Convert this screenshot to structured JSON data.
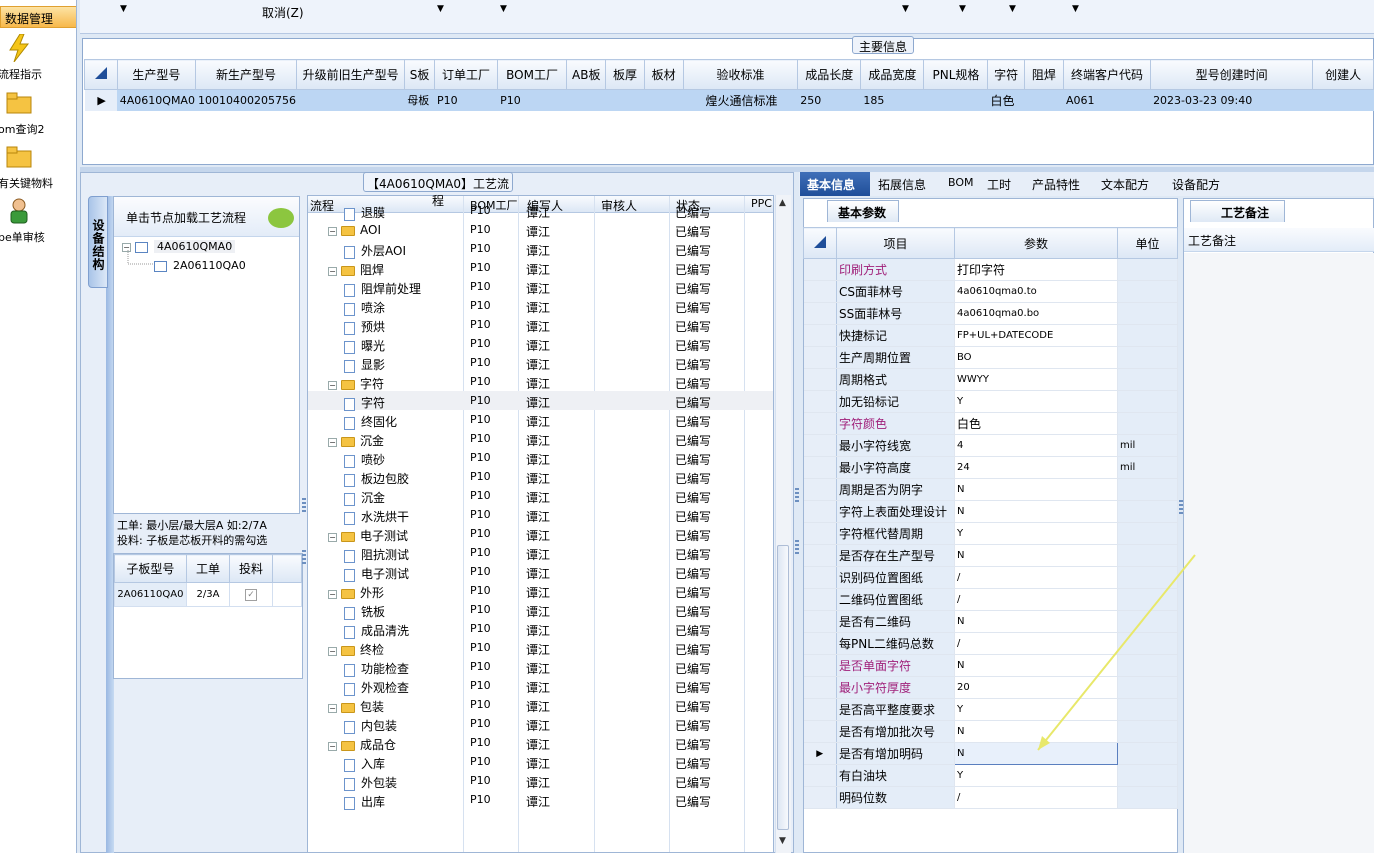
{
  "nav": {
    "header": "数据管理",
    "items": [
      {
        "label": "流程指示",
        "icon": "lightning-icon"
      },
      {
        "label": "om查询2",
        "icon": "folder-icon"
      },
      {
        "label": "有关键物料",
        "icon": "folder-icon"
      },
      {
        "label": "pe单审核",
        "icon": "user-icon"
      }
    ]
  },
  "toolbar": {
    "cancel_label": "取消(Z)"
  },
  "main_info": {
    "legend": "主要信息",
    "columns": [
      "生产型号",
      "新生产型号",
      "升级前旧生产型号",
      "S板",
      "订单工厂",
      "BOM工厂",
      "AB板",
      "板厚",
      "板材",
      "验收标准",
      "成品长度",
      "成品宽度",
      "PNL规格",
      "字符",
      "阻焊",
      "终端客户代码",
      "型号创建时间",
      "创建人"
    ],
    "row": [
      "4A0610QMA0",
      "10010400205756",
      "",
      "母板",
      "P10",
      "P10",
      "",
      "",
      "",
      "煌火通信标准",
      "250",
      "185",
      "",
      "白色",
      "",
      "A061",
      "2023-03-23 09:40",
      ""
    ]
  },
  "process": {
    "legend": "【4A0610QMA0】工艺流程",
    "side_tab": "设备结构",
    "tree_header": "单击节点加载工艺流程",
    "tree": {
      "root": "4A0610QMA0",
      "child": "2A06110QA0"
    },
    "hint_line1": "工单: 最小层/最大层A 如:2/7A",
    "hint_line2": "投料: 子板是芯板开料的需勾选",
    "sub_columns": [
      "子板型号",
      "工单",
      "投料"
    ],
    "sub_row": {
      "model": "2A06110QA0",
      "order": "2/3A",
      "checked": "✓"
    },
    "grid_columns": [
      "流程",
      "BOM工厂",
      "编写人",
      "审核人",
      "状态",
      "PPC"
    ],
    "rows": [
      {
        "name": "退膜",
        "type": "doc",
        "level": 2,
        "bom": "P10",
        "writer": "谭江",
        "status": "已编写"
      },
      {
        "name": "AOI",
        "type": "folder",
        "level": 1,
        "bom": "P10",
        "writer": "谭江",
        "status": "已编写"
      },
      {
        "name": "外层AOI",
        "type": "doc",
        "level": 2,
        "bom": "P10",
        "writer": "谭江",
        "status": "已编写"
      },
      {
        "name": "阻焊",
        "type": "folder",
        "level": 1,
        "bom": "P10",
        "writer": "谭江",
        "status": "已编写"
      },
      {
        "name": "阻焊前处理",
        "type": "doc",
        "level": 2,
        "bom": "P10",
        "writer": "谭江",
        "status": "已编写"
      },
      {
        "name": "喷涂",
        "type": "doc",
        "level": 2,
        "bom": "P10",
        "writer": "谭江",
        "status": "已编写"
      },
      {
        "name": "预烘",
        "type": "doc",
        "level": 2,
        "bom": "P10",
        "writer": "谭江",
        "status": "已编写"
      },
      {
        "name": "曝光",
        "type": "doc",
        "level": 2,
        "bom": "P10",
        "writer": "谭江",
        "status": "已编写"
      },
      {
        "name": "显影",
        "type": "doc",
        "level": 2,
        "bom": "P10",
        "writer": "谭江",
        "status": "已编写"
      },
      {
        "name": "字符",
        "type": "folder",
        "level": 1,
        "bom": "P10",
        "writer": "谭江",
        "status": "已编写"
      },
      {
        "name": "字符",
        "type": "doc",
        "level": 2,
        "bom": "P10",
        "writer": "谭江",
        "status": "已编写",
        "selected": true
      },
      {
        "name": "终固化",
        "type": "doc",
        "level": 2,
        "bom": "P10",
        "writer": "谭江",
        "status": "已编写"
      },
      {
        "name": "沉金",
        "type": "folder",
        "level": 1,
        "bom": "P10",
        "writer": "谭江",
        "status": "已编写"
      },
      {
        "name": "喷砂",
        "type": "doc",
        "level": 2,
        "bom": "P10",
        "writer": "谭江",
        "status": "已编写"
      },
      {
        "name": "板边包胶",
        "type": "doc",
        "level": 2,
        "bom": "P10",
        "writer": "谭江",
        "status": "已编写"
      },
      {
        "name": "沉金",
        "type": "doc",
        "level": 2,
        "bom": "P10",
        "writer": "谭江",
        "status": "已编写"
      },
      {
        "name": "水洗烘干",
        "type": "doc",
        "level": 2,
        "bom": "P10",
        "writer": "谭江",
        "status": "已编写"
      },
      {
        "name": "电子测试",
        "type": "folder",
        "level": 1,
        "bom": "P10",
        "writer": "谭江",
        "status": "已编写"
      },
      {
        "name": "阻抗测试",
        "type": "doc",
        "level": 2,
        "bom": "P10",
        "writer": "谭江",
        "status": "已编写"
      },
      {
        "name": "电子测试",
        "type": "doc",
        "level": 2,
        "bom": "P10",
        "writer": "谭江",
        "status": "已编写"
      },
      {
        "name": "外形",
        "type": "folder",
        "level": 1,
        "bom": "P10",
        "writer": "谭江",
        "status": "已编写"
      },
      {
        "name": "铣板",
        "type": "doc",
        "level": 2,
        "bom": "P10",
        "writer": "谭江",
        "status": "已编写"
      },
      {
        "name": "成品清洗",
        "type": "doc",
        "level": 2,
        "bom": "P10",
        "writer": "谭江",
        "status": "已编写"
      },
      {
        "name": "终检",
        "type": "folder",
        "level": 1,
        "bom": "P10",
        "writer": "谭江",
        "status": "已编写"
      },
      {
        "name": "功能检查",
        "type": "doc",
        "level": 2,
        "bom": "P10",
        "writer": "谭江",
        "status": "已编写"
      },
      {
        "name": "外观检查",
        "type": "doc",
        "level": 2,
        "bom": "P10",
        "writer": "谭江",
        "status": "已编写"
      },
      {
        "name": "包装",
        "type": "folder",
        "level": 1,
        "bom": "P10",
        "writer": "谭江",
        "status": "已编写"
      },
      {
        "name": "内包装",
        "type": "doc",
        "level": 2,
        "bom": "P10",
        "writer": "谭江",
        "status": "已编写"
      },
      {
        "name": "成品仓",
        "type": "folder",
        "level": 1,
        "bom": "P10",
        "writer": "谭江",
        "status": "已编写"
      },
      {
        "name": "入库",
        "type": "doc",
        "level": 2,
        "bom": "P10",
        "writer": "谭江",
        "status": "已编写"
      },
      {
        "name": "外包装",
        "type": "doc",
        "level": 2,
        "bom": "P10",
        "writer": "谭江",
        "status": "已编写"
      },
      {
        "name": "出库",
        "type": "doc",
        "level": 2,
        "bom": "P10",
        "writer": "谭江",
        "status": "已编写"
      }
    ]
  },
  "right": {
    "tabs": [
      "基本信息",
      "拓展信息",
      "BOM",
      "工时",
      "产品特性",
      "文本配方",
      "设备配方"
    ],
    "basic_tab": "基本参数",
    "param_columns": [
      "项目",
      "参数",
      "单位"
    ],
    "params": [
      {
        "item": "印刷方式",
        "value": "打印字符",
        "unit": "",
        "mag": true
      },
      {
        "item": "CS面菲林号",
        "value": "4a0610qma0.to",
        "unit": ""
      },
      {
        "item": "SS面菲林号",
        "value": "4a0610qma0.bo",
        "unit": ""
      },
      {
        "item": "快捷标记",
        "value": "FP+UL+DATECODE",
        "unit": ""
      },
      {
        "item": "生产周期位置",
        "value": "BO",
        "unit": ""
      },
      {
        "item": "周期格式",
        "value": "WWYY",
        "unit": ""
      },
      {
        "item": "加无铅标记",
        "value": "Y",
        "unit": ""
      },
      {
        "item": "字符颜色",
        "value": "白色",
        "unit": "",
        "mag": true
      },
      {
        "item": "最小字符线宽",
        "value": "4",
        "unit": "mil"
      },
      {
        "item": "最小字符高度",
        "value": "24",
        "unit": "mil"
      },
      {
        "item": "周期是否为阴字",
        "value": "N",
        "unit": ""
      },
      {
        "item": "字符上表面处理设计",
        "value": "N",
        "unit": ""
      },
      {
        "item": "字符框代替周期",
        "value": "Y",
        "unit": ""
      },
      {
        "item": "是否存在生产型号",
        "value": "N",
        "unit": ""
      },
      {
        "item": "识别码位置图纸",
        "value": "/",
        "unit": ""
      },
      {
        "item": "二维码位置图纸",
        "value": "/",
        "unit": ""
      },
      {
        "item": "是否有二维码",
        "value": "N",
        "unit": ""
      },
      {
        "item": "每PNL二维码总数",
        "value": "/",
        "unit": ""
      },
      {
        "item": "是否单面字符",
        "value": "N",
        "unit": "",
        "mag": true
      },
      {
        "item": "最小字符厚度",
        "value": "20",
        "unit": "",
        "mag": true
      },
      {
        "item": "是否高平整度要求",
        "value": "Y",
        "unit": ""
      },
      {
        "item": "是否有增加批次号",
        "value": "N",
        "unit": ""
      },
      {
        "item": "是否有增加明码",
        "value": "N",
        "unit": "",
        "editing": true
      },
      {
        "item": "有白油块",
        "value": "Y",
        "unit": ""
      },
      {
        "item": "明码位数",
        "value": "/",
        "unit": ""
      }
    ],
    "note_tab": "工艺备注",
    "note_header": "工艺备注"
  }
}
